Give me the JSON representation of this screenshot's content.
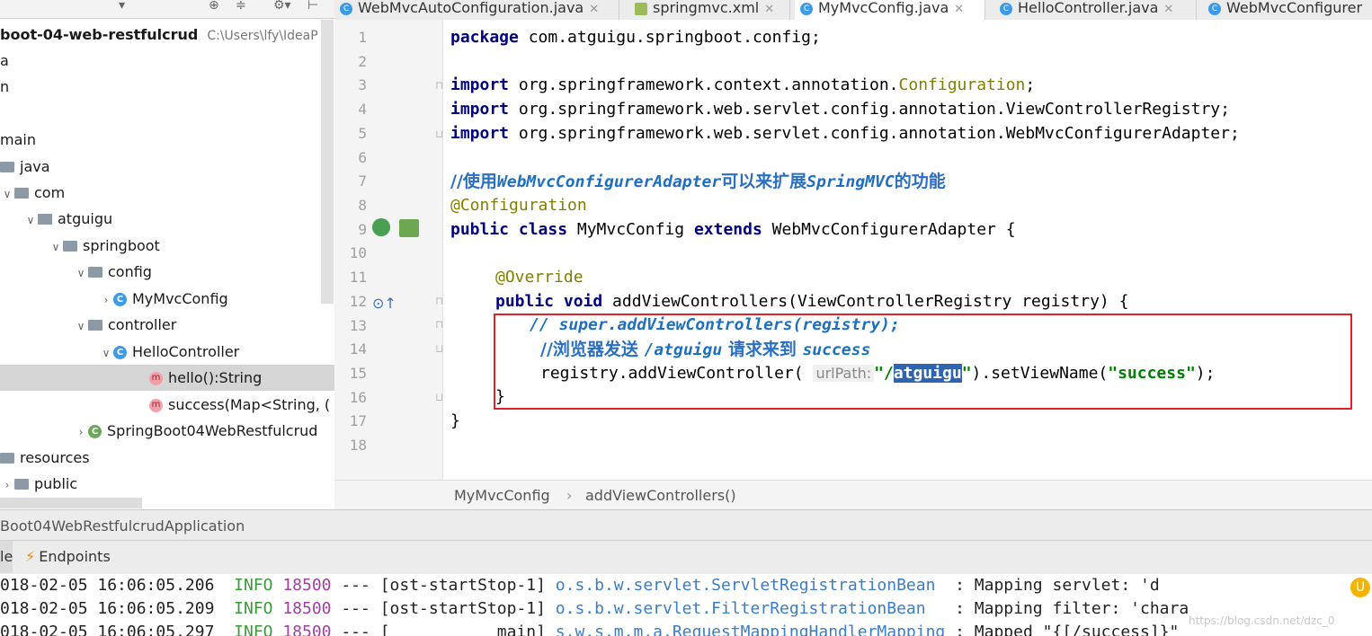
{
  "sidebar": {
    "toolbar_icons": [
      "chevron-down-icon",
      "target-icon",
      "split-icon",
      "gear-icon",
      "collapse-icon"
    ],
    "project_name": "boot-04-web-restfulcrud",
    "project_path": "C:\\Users\\lfy\\IdeaP",
    "tree": [
      {
        "label": "a"
      },
      {
        "label": "n"
      },
      {
        "label": ""
      },
      {
        "label": "main"
      },
      {
        "label": "java"
      },
      {
        "label": "com"
      },
      {
        "label": "atguigu"
      },
      {
        "label": "springboot"
      },
      {
        "label": "config"
      },
      {
        "label": "MyMvcConfig"
      },
      {
        "label": "controller"
      },
      {
        "label": "HelloController"
      },
      {
        "label": "hello():String"
      },
      {
        "label": "success(Map<String, ("
      },
      {
        "label": "SpringBoot04WebRestfulcrud"
      },
      {
        "label": "resources"
      },
      {
        "label": "public"
      }
    ]
  },
  "tabs": [
    {
      "label": "WebMvcAutoConfiguration.java"
    },
    {
      "label": "springmvc.xml"
    },
    {
      "label": "MyMvcConfig.java"
    },
    {
      "label": "HelloController.java"
    },
    {
      "label": "WebMvcConfigurer"
    }
  ],
  "code": {
    "line_numbers": [
      "1",
      "2",
      "3",
      "4",
      "5",
      "6",
      "7",
      "8",
      "9",
      "10",
      "11",
      "12",
      "13",
      "14",
      "15",
      "16",
      "17",
      "18"
    ],
    "l1_kw": "package",
    "l1_rest": " com.atguigu.springboot.config;",
    "import_kw": "import",
    "l3_rest": " org.springframework.context.annotation.",
    "l3_cls": "Configuration",
    "l3_end": ";",
    "l4_rest": " org.springframework.web.servlet.config.annotation.ViewControllerRegistry;",
    "l5_rest": " org.springframework.web.servlet.config.annotation.WebMvcConfigurerAdapter;",
    "l7_comment_a": "//使用",
    "l7_comment_b": "WebMvcConfigurerAdapter",
    "l7_comment_c": "可以来扩展",
    "l7_comment_d": "SpringMVC",
    "l7_comment_e": "的功能",
    "l8_ann": "@Configuration",
    "l9_kw1": "public class",
    "l9_mid": " MyMvcConfig ",
    "l9_kw2": "extends",
    "l9_end": " WebMvcConfigurerAdapter {",
    "l11_ann": "@Override",
    "l12_kw": "public void",
    "l12_rest": " addViewControllers(ViewControllerRegistry registry) {",
    "l13": "// super.addViewControllers(registry);",
    "l14_a": "//浏览器发送 ",
    "l14_b": "/atguigu",
    "l14_c": " 请求来到 ",
    "l14_d": "success",
    "l15_a": "registry.addViewController( ",
    "l15_hint": "urlPath:",
    "l15_str_a": "\"/",
    "l15_sel": "atguigu",
    "l15_str_b": "\"",
    "l15_mid": ").setViewName(",
    "l15_str2": "\"success\"",
    "l15_end": ");",
    "l16": "}",
    "l17": "}"
  },
  "breadcrumb": {
    "class": "MyMvcConfig",
    "sep": "›",
    "method": "addViewControllers()"
  },
  "statusbar": {
    "text": "Boot04WebRestfulcrudApplication"
  },
  "run_tabs": [
    {
      "label": "le"
    },
    {
      "label": "Endpoints"
    }
  ],
  "console": [
    {
      "ts": "018-02-05 16:06:05.206",
      "level": "INFO",
      "pid": "18500",
      "dash": "---",
      "thread": "[ost-startStop-1]",
      "logger": "o.s.b.w.servlet.ServletRegistrationBean",
      "msg": ": Mapping servlet: 'd"
    },
    {
      "ts": "018-02-05 16:06:05.209",
      "level": "INFO",
      "pid": "18500",
      "dash": "---",
      "thread": "[ost-startStop-1]",
      "logger": "o.s.b.w.servlet.FilterRegistrationBean",
      "msg": ": Mapping filter: 'chara"
    },
    {
      "ts": "018-02-05 16:06:05.297",
      "level": "INFO",
      "pid": "18500",
      "dash": "---",
      "thread": "[           main]",
      "logger": "s.w.s.m.m.a.RequestMappingHandlerMapping",
      "msg": ": Mapped \"{[/success]}\""
    }
  ],
  "watermark": "https://blog.csdn.net/dzc_0",
  "colors": {
    "selection": "#2f65b0",
    "highlight_box": "#e0202a",
    "keyword": "#000080",
    "string": "#008000",
    "annotation": "#808000"
  }
}
